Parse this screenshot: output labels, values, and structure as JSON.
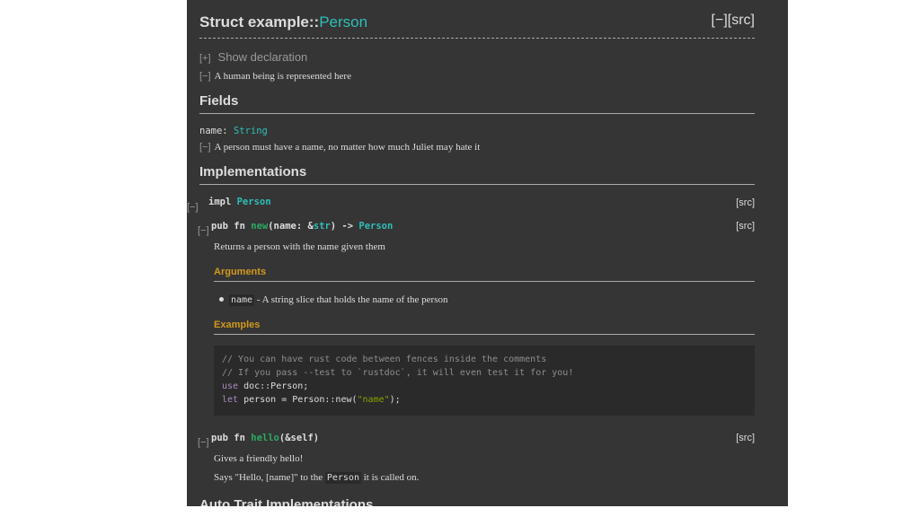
{
  "struct": {
    "title_prefix": "Struct example::",
    "title_name": "Person",
    "title_src": "[−][src]",
    "show_decl_toggle": "[+]",
    "show_decl_label": "Show declaration",
    "doc_toggle": "[−]",
    "doc": "A human being is represented here"
  },
  "fields": {
    "heading": "Fields",
    "name_label": "name: ",
    "name_type": "String",
    "doc_toggle": "[−]",
    "doc": "A person must have a name, no matter how much Juliet may hate it"
  },
  "implementations": {
    "heading": "Implementations",
    "impl_toggle": "[−]",
    "impl_kw": "impl ",
    "impl_type": "Person",
    "impl_src": "[src]",
    "new_fn": {
      "toggle": "[−]",
      "sig_prefix": "pub fn ",
      "name": "new",
      "args_open": "(name: &",
      "arg_type": "str",
      "args_close": ") -> ",
      "ret_type": "Person",
      "src": "[src]",
      "doc": "Returns a person with the name given them",
      "arguments_heading": "Arguments",
      "arg_code": "name",
      "arg_desc": " - A string slice that holds the name of the person",
      "examples_heading": "Examples",
      "code": {
        "line1": "// You can have rust code between fences inside the comments",
        "line2": "// If you pass --test to `rustdoc`, it will even test it for you!",
        "line3_kw": "use",
        "line3_rest": " doc::Person;",
        "line4_kw": "let",
        "line4_mid": " person = Person::new(",
        "line4_str": "\"name\"",
        "line4_end": ");"
      }
    },
    "hello_fn": {
      "toggle": "[−]",
      "sig_prefix": "pub fn ",
      "name": "hello",
      "args": "(&self)",
      "src": "[src]",
      "doc1": "Gives a friendly hello!",
      "doc2_prefix": "Says \"Hello, [name]\" to the ",
      "doc2_code": "Person",
      "doc2_suffix": " it is called on."
    }
  },
  "next_heading": "Auto Trait Implementations"
}
